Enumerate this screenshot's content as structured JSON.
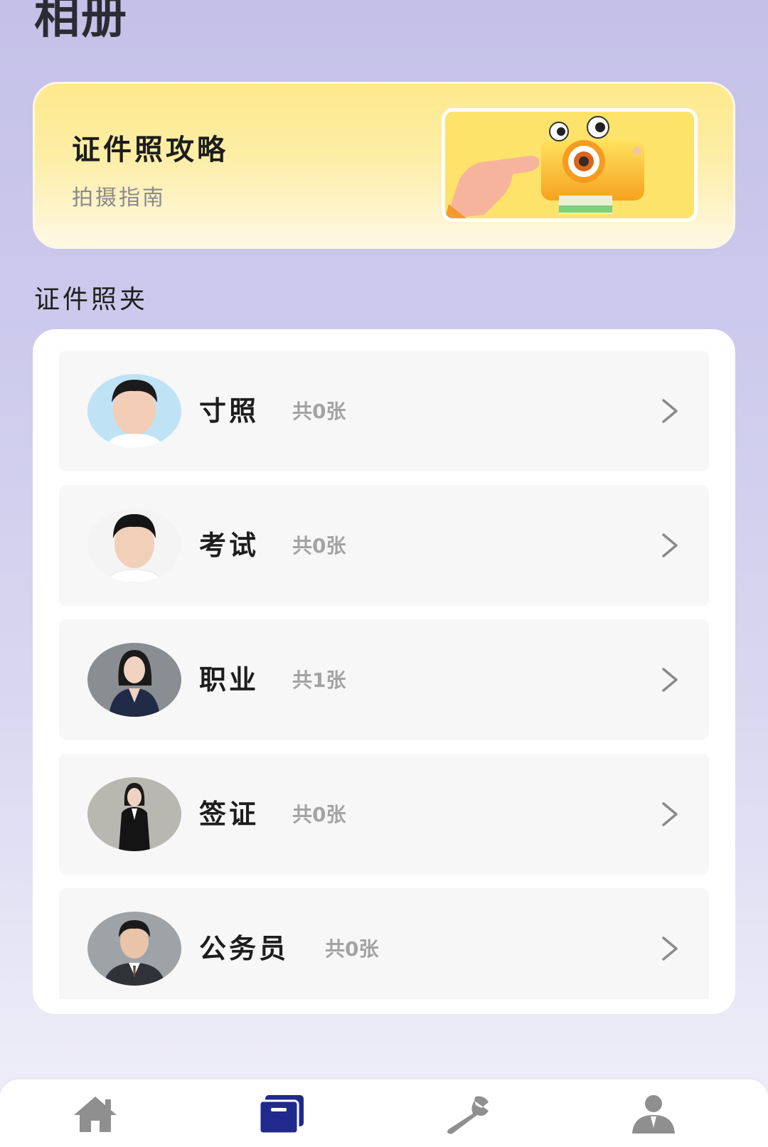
{
  "header": {
    "title": "相册"
  },
  "guide_card": {
    "title": "证件照攻略",
    "subtitle": "拍摄指南"
  },
  "section": {
    "title": "证件照夹"
  },
  "folders": [
    {
      "name": "寸照",
      "count": "共0张",
      "avatar_bg": "#bfe3f5"
    },
    {
      "name": "考试",
      "count": "共0张",
      "avatar_bg": "#f4f4f4"
    },
    {
      "name": "职业",
      "count": "共1张",
      "avatar_bg": "#8a8d92"
    },
    {
      "name": "签证",
      "count": "共0张",
      "avatar_bg": "#b8b7b0"
    },
    {
      "name": "公务员",
      "count": "共0张",
      "avatar_bg": "#9ea3a8"
    }
  ],
  "tabbar": {
    "items": [
      {
        "icon": "home-icon",
        "active": false
      },
      {
        "icon": "album-icon",
        "active": true
      },
      {
        "icon": "wrench-icon",
        "active": false
      },
      {
        "icon": "person-icon",
        "active": false
      }
    ],
    "active_color": "#1f2a8c",
    "inactive_color": "#8f8f8f"
  }
}
